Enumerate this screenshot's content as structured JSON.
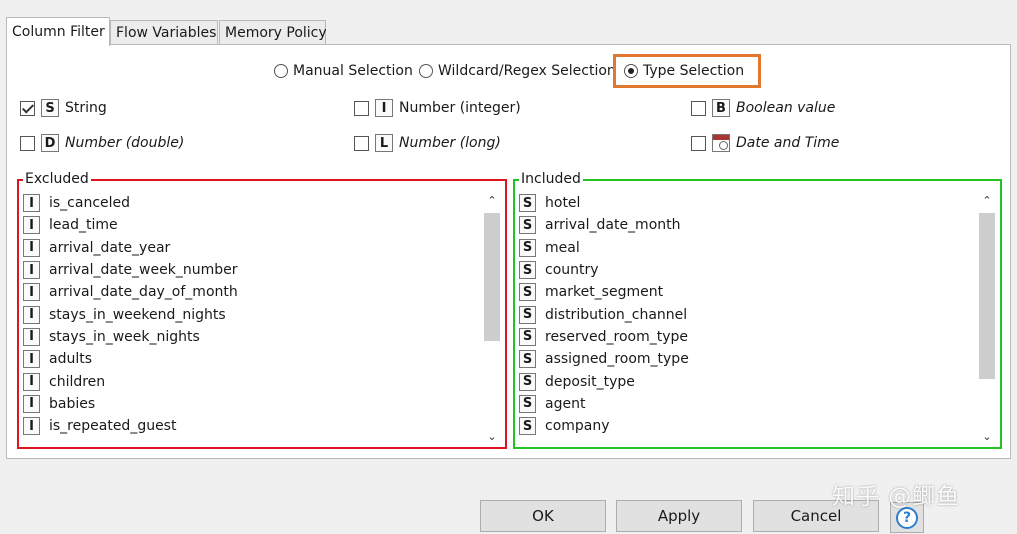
{
  "tabs": [
    "Column Filter",
    "Flow Variables",
    "Memory Policy"
  ],
  "selection_modes": {
    "manual": "Manual Selection",
    "wildcard": "Wildcard/Regex Selection",
    "type": "Type Selection",
    "selected": "Type Selection"
  },
  "type_options": [
    {
      "badge": "S",
      "label": "String",
      "checked": true,
      "italic": false
    },
    {
      "badge": "I",
      "label": "Number (integer)",
      "checked": false,
      "italic": false
    },
    {
      "badge": "B",
      "label": "Boolean value",
      "checked": false,
      "italic": true
    },
    {
      "badge": "D",
      "label": "Number (double)",
      "checked": false,
      "italic": true
    },
    {
      "badge": "L",
      "label": "Number (long)",
      "checked": false,
      "italic": true
    },
    {
      "badge": "calendar-icon",
      "label": "Date and Time",
      "checked": false,
      "italic": true
    }
  ],
  "excluded": {
    "title": "Excluded",
    "border_color": "#e0141e",
    "items": [
      {
        "type": "I",
        "name": "is_canceled"
      },
      {
        "type": "I",
        "name": "lead_time"
      },
      {
        "type": "I",
        "name": "arrival_date_year"
      },
      {
        "type": "I",
        "name": "arrival_date_week_number"
      },
      {
        "type": "I",
        "name": "arrival_date_day_of_month"
      },
      {
        "type": "I",
        "name": "stays_in_weekend_nights"
      },
      {
        "type": "I",
        "name": "stays_in_week_nights"
      },
      {
        "type": "I",
        "name": "adults"
      },
      {
        "type": "I",
        "name": "children"
      },
      {
        "type": "I",
        "name": "babies"
      },
      {
        "type": "I",
        "name": "is_repeated_guest"
      }
    ]
  },
  "included": {
    "title": "Included",
    "border_color": "#22c322",
    "items": [
      {
        "type": "S",
        "name": "hotel"
      },
      {
        "type": "S",
        "name": "arrival_date_month"
      },
      {
        "type": "S",
        "name": "meal"
      },
      {
        "type": "S",
        "name": "country"
      },
      {
        "type": "S",
        "name": "market_segment"
      },
      {
        "type": "S",
        "name": "distribution_channel"
      },
      {
        "type": "S",
        "name": "reserved_room_type"
      },
      {
        "type": "S",
        "name": "assigned_room_type"
      },
      {
        "type": "S",
        "name": "deposit_type"
      },
      {
        "type": "S",
        "name": "agent"
      },
      {
        "type": "S",
        "name": "company"
      }
    ]
  },
  "buttons": {
    "ok": "OK",
    "apply": "Apply",
    "cancel": "Cancel",
    "help": "?"
  },
  "watermark": "知乎 @鲫鱼",
  "colors": {
    "highlight": "#e2782d",
    "help": "#2f7fd0"
  }
}
